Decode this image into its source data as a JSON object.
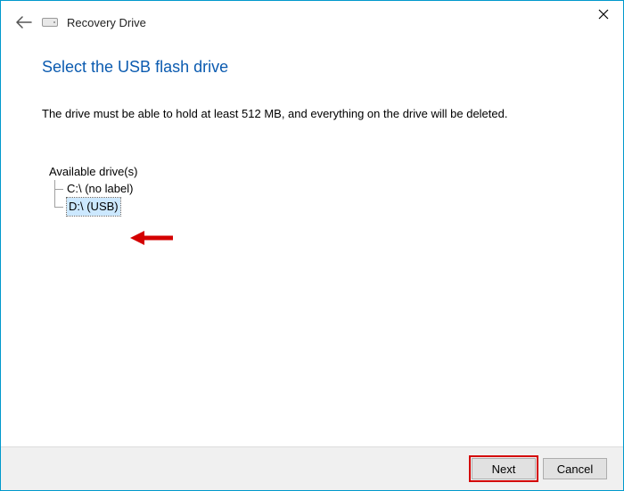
{
  "window": {
    "app_title": "Recovery Drive"
  },
  "page": {
    "title": "Select the USB flash drive",
    "instruction": "The drive must be able to hold at least 512 MB, and everything on the drive will be deleted."
  },
  "drives": {
    "label": "Available drive(s)",
    "items": [
      {
        "text": "C:\\ (no label)",
        "selected": false
      },
      {
        "text": "D:\\ (USB)",
        "selected": true
      }
    ]
  },
  "buttons": {
    "next": "Next",
    "cancel": "Cancel"
  }
}
